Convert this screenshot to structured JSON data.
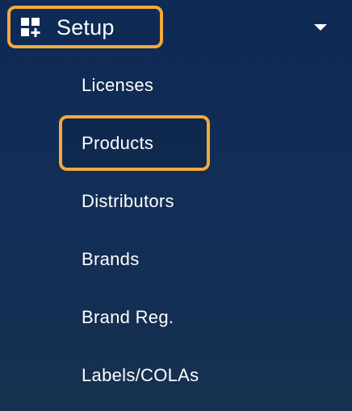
{
  "colors": {
    "background": "#102a50",
    "highlight": "#f3a93b",
    "text": "#ffffff"
  },
  "menu": {
    "section_label": "Setup",
    "section_icon": "dashboard-add-icon",
    "expanded": true,
    "items": [
      {
        "label": "Licenses"
      },
      {
        "label": "Products",
        "highlighted": true
      },
      {
        "label": "Distributors"
      },
      {
        "label": "Brands"
      },
      {
        "label": "Brand Reg."
      },
      {
        "label": "Labels/COLAs"
      }
    ]
  }
}
